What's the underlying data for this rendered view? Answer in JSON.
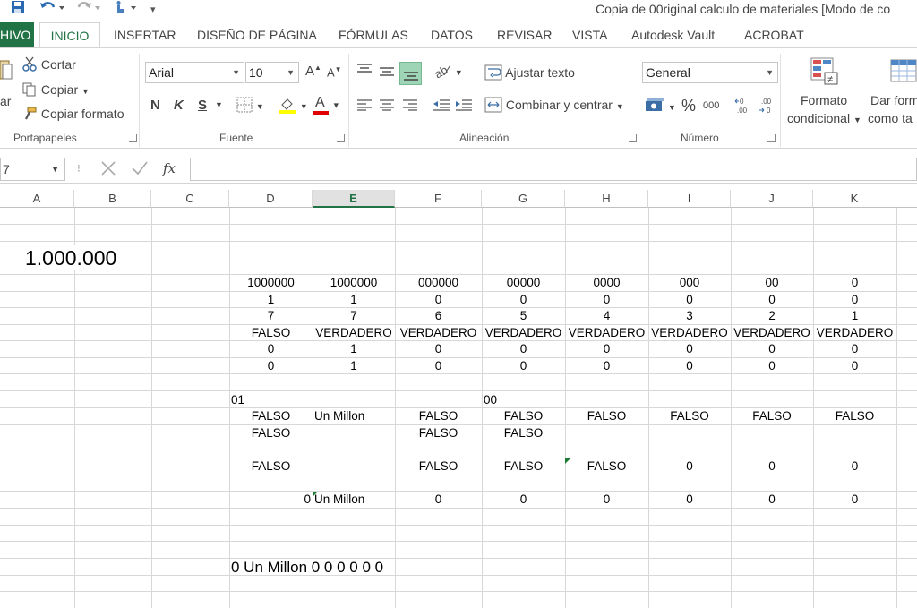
{
  "titlebar": {
    "title": "Copia de 00riginal calculo de materiales  [Modo de co"
  },
  "tabs": [
    "HIVO",
    "INICIO",
    "INSERTAR",
    "DISEÑO DE PÁGINA",
    "FÓRMULAS",
    "DATOS",
    "REVISAR",
    "VISTA",
    "Autodesk Vault",
    "ACROBAT"
  ],
  "ribbon": {
    "clipboard": {
      "paste": "ar",
      "cut": "Cortar",
      "copy": "Copiar",
      "format_painter": "Copiar formato",
      "label": "Portapapeles"
    },
    "font": {
      "name": "Arial",
      "size": "10",
      "bold": "N",
      "italic": "K",
      "underline": "S",
      "label": "Fuente",
      "grow": "A",
      "shrink": "A",
      "color_letter": "A"
    },
    "alignment": {
      "wrap": "Ajustar texto",
      "merge": "Combinar y centrar",
      "label": "Alineación"
    },
    "number": {
      "format": "General",
      "percent": "%",
      "thousands": "000",
      "label": "Número",
      "inc": "←0\n.00",
      "dec": ".00\n→0"
    },
    "styles": {
      "conditional_line1": "Formato",
      "conditional_line2": "condicional",
      "table_line1": "Dar form",
      "table_line2": "como ta"
    }
  },
  "formula_bar": {
    "name_box": "7",
    "fx": "fx",
    "content": ""
  },
  "columns": [
    "A",
    "B",
    "C",
    "D",
    "E",
    "F",
    "G",
    "H",
    "I",
    "J",
    "K"
  ],
  "selected_column": "E",
  "cells": {
    "big_number": "1.000.000",
    "row_masks": [
      "1000000",
      "1000000",
      "000000",
      "00000",
      "0000",
      "000",
      "00",
      "0"
    ],
    "row_digits": [
      "1",
      "1",
      "0",
      "0",
      "0",
      "0",
      "0",
      "0"
    ],
    "row_lengths": [
      "7",
      "7",
      "6",
      "5",
      "4",
      "3",
      "2",
      "1"
    ],
    "row_bools": [
      "FALSO",
      "VERDADERO",
      "VERDADERO",
      "VERDADERO",
      "VERDADERO",
      "VERDADERO",
      "VERDADERO",
      "VERDADERO"
    ],
    "row_zero1": [
      "0",
      "1",
      "0",
      "0",
      "0",
      "0",
      "0",
      "0"
    ],
    "row_zero2": [
      "0",
      "1",
      "0",
      "0",
      "0",
      "0",
      "0",
      "0"
    ],
    "d_01": "01",
    "g_00": "00",
    "row_words1": [
      "FALSO",
      "Un Millon",
      "FALSO",
      "FALSO",
      "FALSO",
      "FALSO",
      "FALSO",
      "FALSO"
    ],
    "row_words2": [
      "FALSO",
      "",
      "FALSO",
      "FALSO",
      "",
      "",
      "",
      ""
    ],
    "row_words3": [
      "FALSO",
      "",
      "FALSO",
      "FALSO",
      "FALSO",
      "0",
      "0",
      "0"
    ],
    "row_final": [
      "0",
      "Un Millon",
      "0",
      "0",
      "0",
      "0",
      "0",
      "0"
    ],
    "result": "0 Un Millon 0 0 0 0 0 0"
  }
}
